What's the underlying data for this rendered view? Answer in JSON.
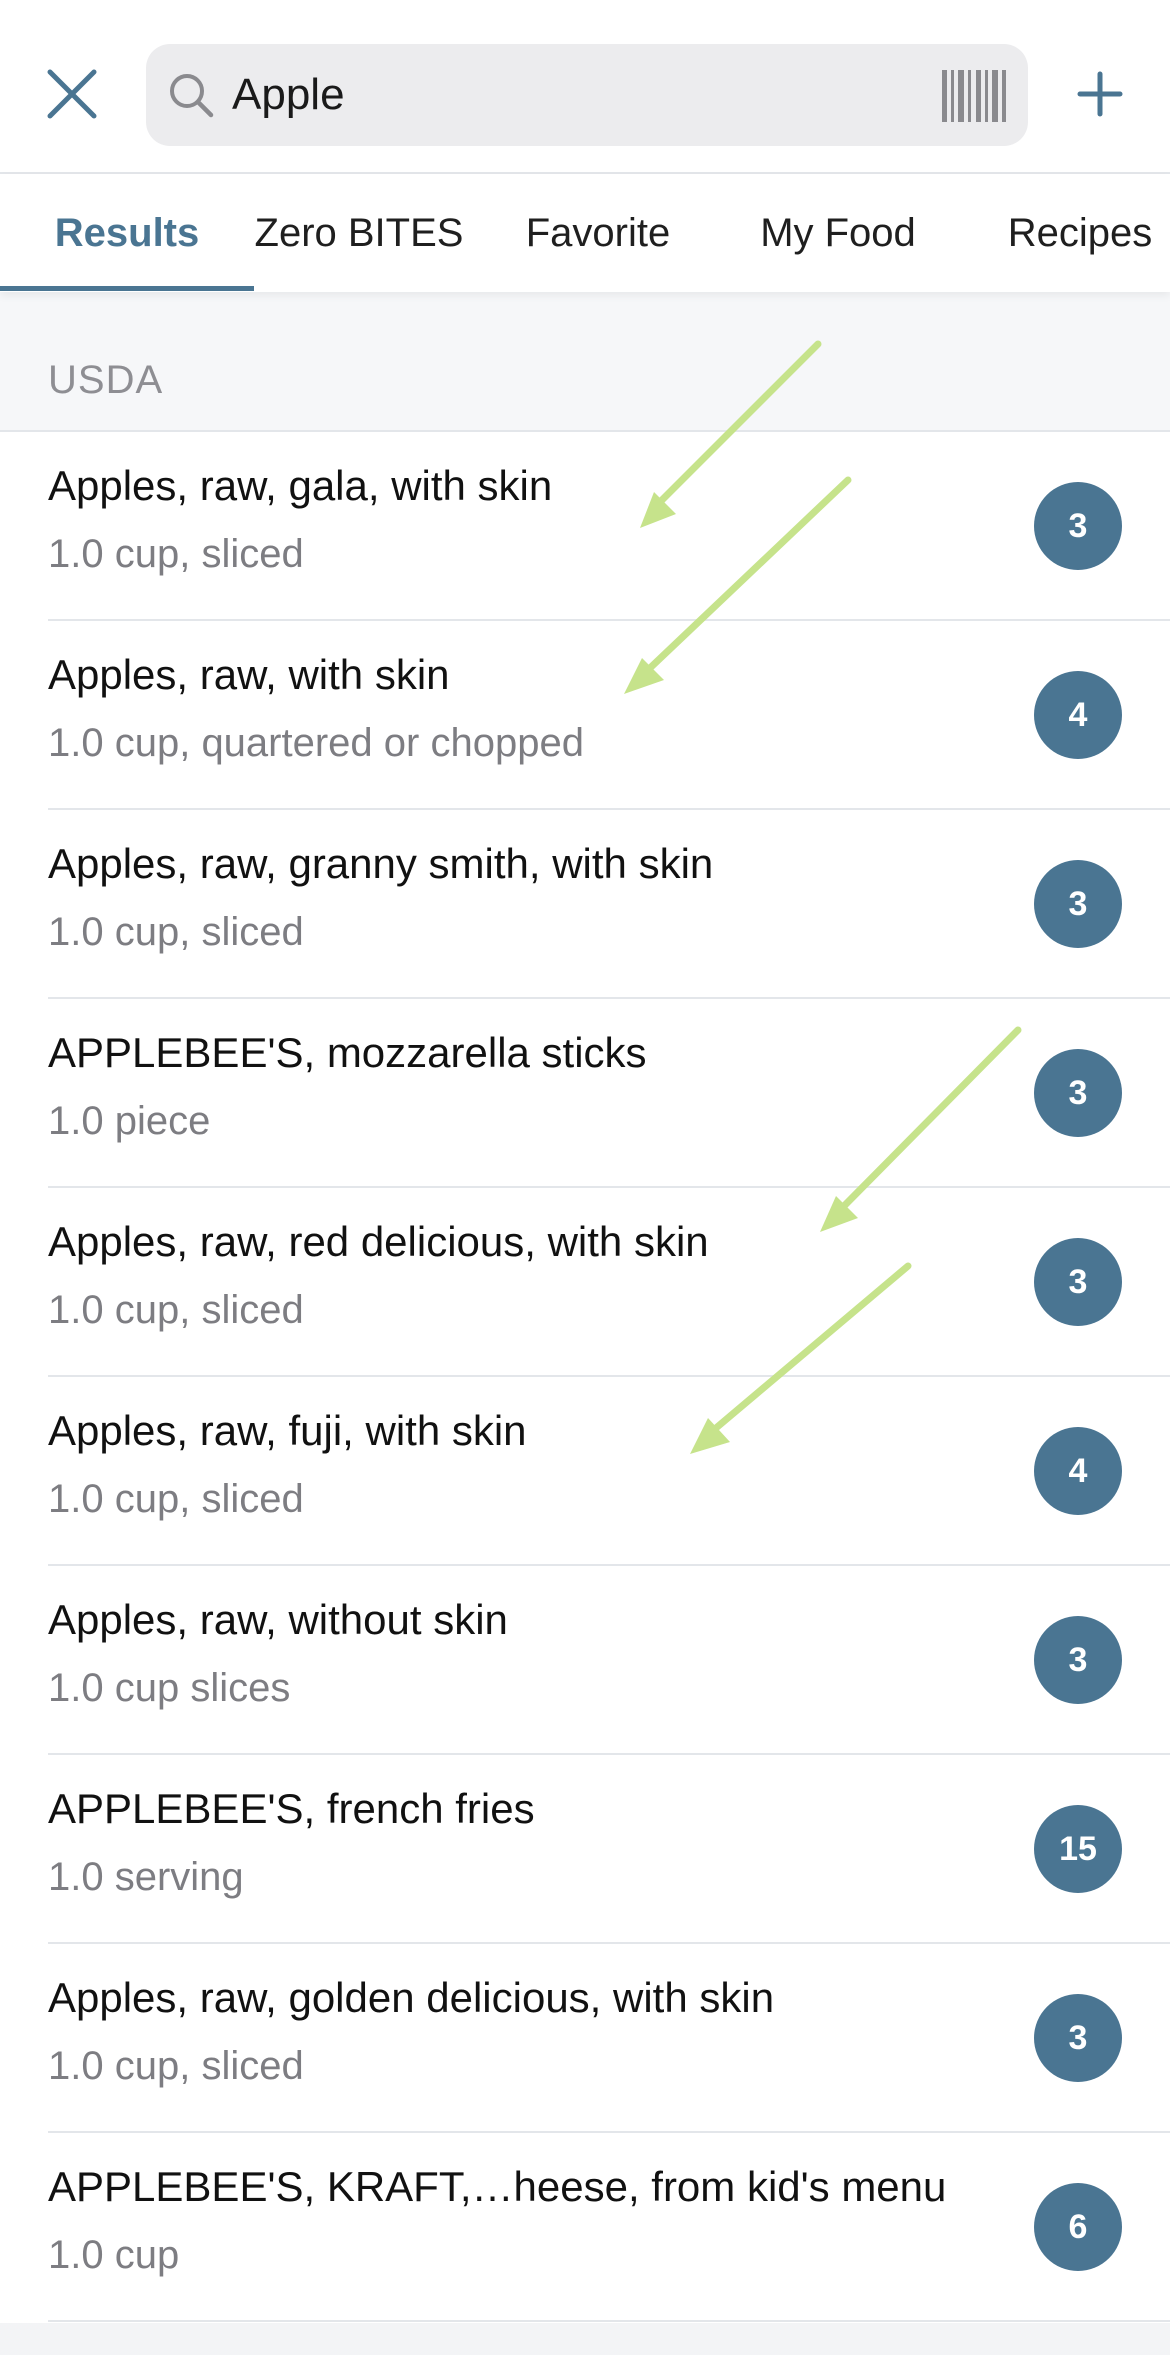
{
  "search": {
    "query": "Apple",
    "close_icon": "close-icon",
    "search_icon": "search-icon",
    "barcode_icon": "barcode-icon",
    "add_icon": "plus-icon"
  },
  "tabs": [
    {
      "label": "Results",
      "active": true
    },
    {
      "label": "Zero BITES",
      "active": false
    },
    {
      "label": "Favorite",
      "active": false
    },
    {
      "label": "My Food",
      "active": false
    },
    {
      "label": "Recipes",
      "active": false
    }
  ],
  "section": {
    "label": "USDA"
  },
  "results": [
    {
      "name": "Apples, raw, gala, with skin",
      "serving": "1.0 cup, sliced",
      "bites": "3"
    },
    {
      "name": "Apples, raw, with skin",
      "serving": "1.0 cup, quartered or chopped",
      "bites": "4"
    },
    {
      "name": "Apples, raw, granny smith, with skin",
      "serving": "1.0 cup, sliced",
      "bites": "3"
    },
    {
      "name": "APPLEBEE'S, mozzarella sticks",
      "serving": "1.0 piece",
      "bites": "3"
    },
    {
      "name": "Apples, raw, red delicious, with skin",
      "serving": "1.0 cup, sliced",
      "bites": "3"
    },
    {
      "name": "Apples, raw, fuji, with skin",
      "serving": "1.0 cup, sliced",
      "bites": "4"
    },
    {
      "name": "Apples, raw, without skin",
      "serving": "1.0 cup slices",
      "bites": "3"
    },
    {
      "name": "APPLEBEE'S, french fries",
      "serving": "1.0 serving",
      "bites": "15"
    },
    {
      "name": "Apples, raw, golden delicious, with skin",
      "serving": "1.0 cup, sliced",
      "bites": "3"
    },
    {
      "name": "APPLEBEE'S, KRAFT,…heese, from kid's menu",
      "serving": "1.0 cup",
      "bites": "6"
    }
  ],
  "colors": {
    "accent": "#4a7592",
    "annotation_arrow": "#c6e38b",
    "secondary_text": "#7d7d82"
  }
}
